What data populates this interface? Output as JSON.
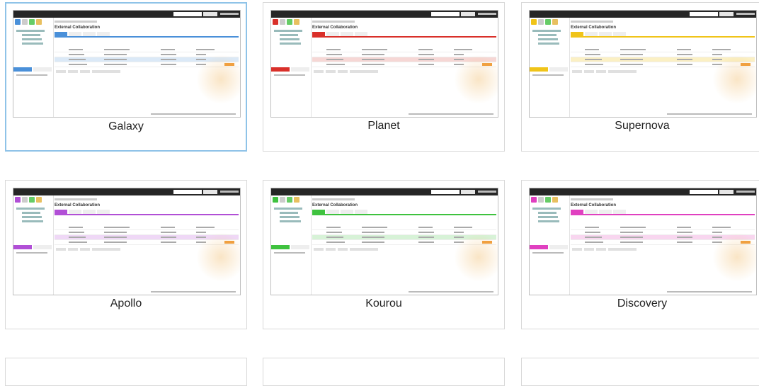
{
  "themes": [
    {
      "name": "Galaxy",
      "selected": true,
      "accent": "#4a90d9",
      "tint": "#dbe9f7"
    },
    {
      "name": "Planet",
      "selected": false,
      "accent": "#d9302a",
      "tint": "#f6d7d5"
    },
    {
      "name": "Supernova",
      "selected": false,
      "accent": "#f0c419",
      "tint": "#fbf0c4"
    },
    {
      "name": "Apollo",
      "selected": false,
      "accent": "#b14fd6",
      "tint": "#efd8f6"
    },
    {
      "name": "Kourou",
      "selected": false,
      "accent": "#3fc23f",
      "tint": "#d7f2d7"
    },
    {
      "name": "Discovery",
      "selected": false,
      "accent": "#e040c0",
      "tint": "#f8d6ef"
    }
  ],
  "thumb": {
    "title": "External Collaboration"
  }
}
